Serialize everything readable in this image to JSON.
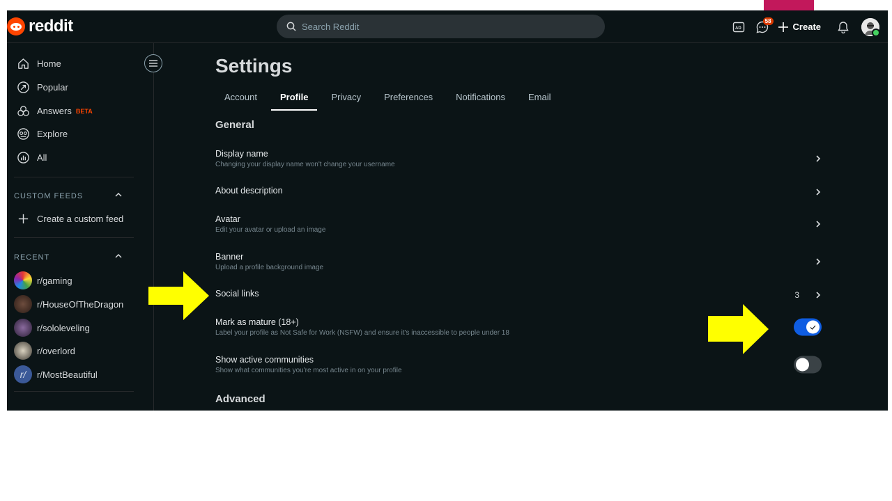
{
  "app": {
    "logo_text": "reddit"
  },
  "search": {
    "placeholder": "Search Reddit"
  },
  "header": {
    "chat_badge": "58",
    "create_label": "Create"
  },
  "sidebar": {
    "nav": [
      {
        "label": "Home"
      },
      {
        "label": "Popular"
      },
      {
        "label": "Answers",
        "badge": "BETA"
      },
      {
        "label": "Explore"
      },
      {
        "label": "All"
      }
    ],
    "custom_feeds_label": "CUSTOM FEEDS",
    "create_feed_label": "Create a custom feed",
    "recent_label": "RECENT",
    "recent": [
      {
        "label": "r/gaming"
      },
      {
        "label": "r/HouseOfTheDragon"
      },
      {
        "label": "r/sololeveling"
      },
      {
        "label": "r/overlord"
      },
      {
        "label": "r/MostBeautiful"
      }
    ]
  },
  "settings": {
    "title": "Settings",
    "tabs": [
      {
        "label": "Account"
      },
      {
        "label": "Profile",
        "active": true
      },
      {
        "label": "Privacy"
      },
      {
        "label": "Preferences"
      },
      {
        "label": "Notifications"
      },
      {
        "label": "Email"
      }
    ],
    "general_label": "General",
    "rows": [
      {
        "title": "Display name",
        "desc": "Changing your display name won't change your username"
      },
      {
        "title": "About description",
        "desc": ""
      },
      {
        "title": "Avatar",
        "desc": "Edit your avatar or upload an image"
      },
      {
        "title": "Banner",
        "desc": "Upload a profile background image"
      },
      {
        "title": "Social links",
        "desc": "",
        "count": "3"
      },
      {
        "title": "Mark as mature (18+)",
        "desc": "Label your profile as Not Safe for Work (NSFW) and ensure it's inaccessible to people under 18",
        "toggle": true
      },
      {
        "title": "Show active communities",
        "desc": "Show what communities you're most active in on your profile",
        "toggle": false
      }
    ],
    "advanced_label": "Advanced"
  },
  "colors": {
    "background": "#0b1416",
    "brand": "#ff4500",
    "toggle_on": "#0f5de2",
    "annotation_arrow": "#ffff00",
    "top_tab": "#c2185b"
  }
}
